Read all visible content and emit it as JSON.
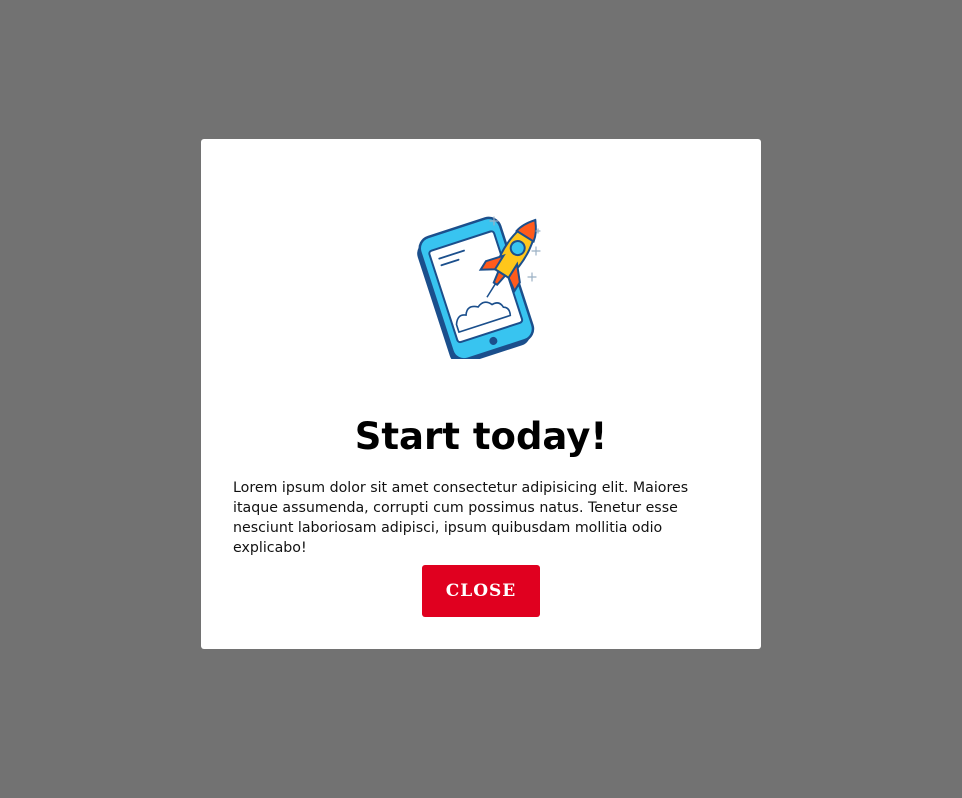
{
  "modal": {
    "illustration": "phone-rocket-launch-illustration",
    "title": "Start today!",
    "body": "Lorem ipsum dolor sit amet consectetur adipisicing elit. Maiores itaque assumenda, corrupti cum possimus natus. Tenetur esse nesciunt laboriosam adipisci, ipsum quibusdam mollitia odio explicabo!",
    "close_label": "CLOSE"
  },
  "colors": {
    "overlay": "#727272",
    "modal_bg": "#ffffff",
    "button_bg": "#e0001f",
    "button_text": "#ffffff",
    "phone": "#38c4f0",
    "phone_dark": "#1b4f8c",
    "rocket_body": "#ffc61b",
    "rocket_fin": "#ff5b1c"
  }
}
